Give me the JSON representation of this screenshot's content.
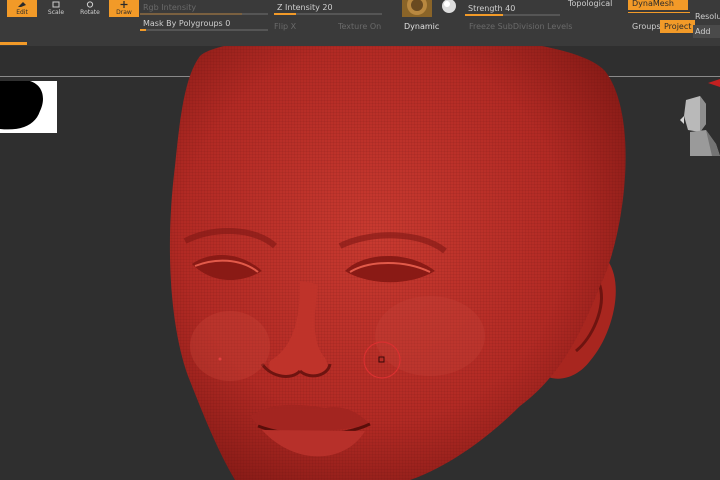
{
  "toolbar": {
    "tools": [
      {
        "label": "Edit",
        "active": true,
        "icon": "edit-icon"
      },
      {
        "label": "Scale",
        "active": false,
        "icon": "scale-icon"
      },
      {
        "label": "Rotate",
        "active": false,
        "icon": "rotate-icon"
      },
      {
        "label": "Draw",
        "active": true,
        "icon": "draw-icon"
      }
    ],
    "rgb_intensity": {
      "label": "Rgb Intensity",
      "value": 0.8
    },
    "z_intensity": {
      "label": "Z Intensity 20",
      "value": 0.2
    },
    "mask_by_polygroups": {
      "label": "Mask By Polygroups 0",
      "value": 0.0
    },
    "flip_x": "Flip X",
    "texture_on": "Texture On",
    "dynamic": "Dynamic",
    "strength": {
      "label": "Strength 40",
      "value": 0.4
    },
    "freeze_subdivision": "Freeze SubDivision Levels",
    "topological": "Topological",
    "dynamesh": "DynaMesh",
    "resolution": "Resolu",
    "groups": "Groups",
    "project": "Project",
    "add": "Add"
  },
  "colors": {
    "accent": "#f29a28",
    "mesh": "#b22a24",
    "background": "#2f2f2f"
  }
}
